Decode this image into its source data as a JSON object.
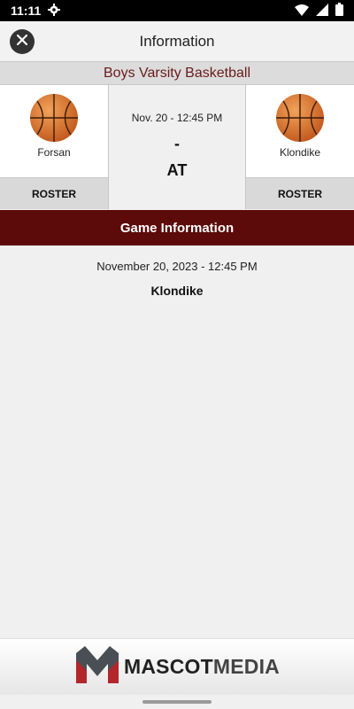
{
  "status_bar": {
    "time": "11:11"
  },
  "header": {
    "title": "Information"
  },
  "sport": {
    "title": "Boys Varsity Basketball"
  },
  "matchup": {
    "home": {
      "name": "Forsan",
      "roster_label": "ROSTER"
    },
    "away": {
      "name": "Klondike",
      "roster_label": "ROSTER"
    },
    "time_short": "Nov. 20 - 12:45 PM",
    "score": "-",
    "location_type": "AT"
  },
  "section": {
    "title": "Game Information"
  },
  "game_info": {
    "date_time": "November 20, 2023 - 12:45 PM",
    "location": "Klondike"
  },
  "footer": {
    "brand_part1": "MASCOT",
    "brand_part2": "MEDIA"
  },
  "colors": {
    "maroon": "#5c0a0a",
    "sport_text": "#6b1a1a"
  },
  "icons": [
    "gear-icon",
    "wifi-icon",
    "signal-icon",
    "battery-icon",
    "close-icon",
    "basketball-icon",
    "mascot-media-logo"
  ]
}
